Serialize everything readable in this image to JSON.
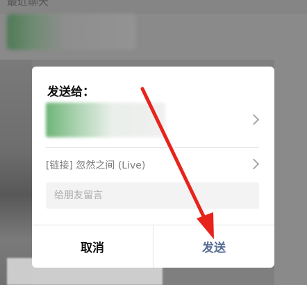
{
  "background": {
    "header_text": "最近聊天"
  },
  "dialog": {
    "title": "发送给：",
    "link_text": "[链接] 忽然之间 (Live)",
    "message_placeholder": "给朋友留言",
    "cancel_label": "取消",
    "send_label": "发送"
  },
  "colors": {
    "send_accent": "#576b95",
    "annotation_arrow": "#e8231b",
    "overlay_dim": "#7f7f7f"
  },
  "icons": {
    "recipient_chevron": "chevron-right-icon",
    "link_chevron": "chevron-right-icon",
    "annotation": "red-arrow-icon"
  }
}
